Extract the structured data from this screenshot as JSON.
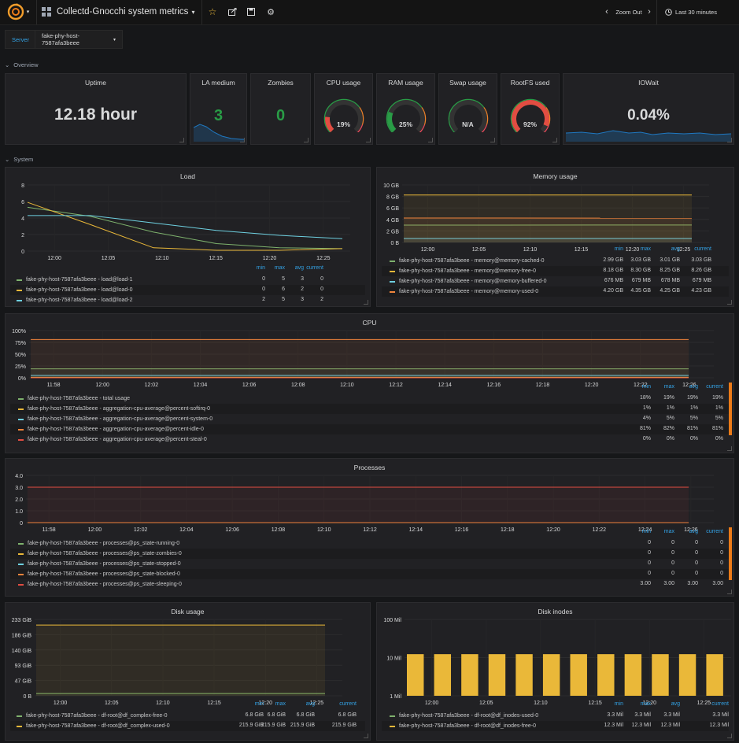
{
  "topbar": {
    "title": "Collectd-Gnocchi system metrics",
    "title_caret": "▾",
    "zoom_out": "Zoom Out",
    "time_range": "Last 30 minutes"
  },
  "variables": {
    "server_label": "Server",
    "server_value": "fake-phy-host-7587afa3beee"
  },
  "rows": {
    "overview": "Overview",
    "system": "System"
  },
  "stats": {
    "uptime": {
      "title": "Uptime",
      "value": "12.18 hour"
    },
    "la_medium": {
      "title": "LA medium",
      "value": "3"
    },
    "zombies": {
      "title": "Zombies",
      "value": "0"
    },
    "cpu_usage": {
      "title": "CPU usage",
      "value": "19%",
      "level": 0.19,
      "color": "#e24d42"
    },
    "ram_usage": {
      "title": "RAM usage",
      "value": "25%",
      "level": 0.25,
      "color": "#299c46"
    },
    "swap_usage": {
      "title": "Swap usage",
      "value": "N/A",
      "level": 0,
      "color": "#299c46"
    },
    "rootfs_used": {
      "title": "RootFS used",
      "value": "92%",
      "level": 0.92,
      "color": "#e24d42"
    },
    "iowait": {
      "title": "IOWait",
      "value": "0.04%"
    }
  },
  "colors": {
    "green": "#7eb26d",
    "yellow": "#eab839",
    "cyan": "#6ed0e0",
    "orange": "#ef843c",
    "red": "#e24d42",
    "blue_header": "#33a2e5",
    "stat_green": "#299c46"
  },
  "legend_headers": {
    "min": "min",
    "max": "max",
    "avg": "avg",
    "current": "current"
  },
  "panels": {
    "load": {
      "title": "Load",
      "yticks": [
        "8",
        "6",
        "4",
        "2",
        "0"
      ],
      "xticks": [
        "12:00",
        "12:05",
        "12:10",
        "12:15",
        "12:20",
        "12:25"
      ],
      "legend": [
        {
          "name": "fake-phy-host-7587afa3beee - load@load-1",
          "min": "0",
          "max": "5",
          "avg": "3",
          "current": "0"
        },
        {
          "name": "fake-phy-host-7587afa3beee - load@load-0",
          "min": "0",
          "max": "6",
          "avg": "2",
          "current": "0"
        },
        {
          "name": "fake-phy-host-7587afa3beee - load@load-2",
          "min": "2",
          "max": "5",
          "avg": "3",
          "current": "2"
        }
      ]
    },
    "memory": {
      "title": "Memory usage",
      "yticks": [
        "10 GB",
        "8 GB",
        "6 GB",
        "4 GB",
        "2 GB",
        "0 B"
      ],
      "xticks": [
        "12:00",
        "12:05",
        "12:10",
        "12:15",
        "12:20",
        "12:25"
      ],
      "legend": [
        {
          "name": "fake-phy-host-7587afa3beee - memory@memory-cached-0",
          "min": "2.99 GB",
          "max": "3.03 GB",
          "avg": "3.01 GB",
          "current": "3.03 GB"
        },
        {
          "name": "fake-phy-host-7587afa3beee - memory@memory-free-0",
          "min": "8.18 GB",
          "max": "8.30 GB",
          "avg": "8.25 GB",
          "current": "8.26 GB"
        },
        {
          "name": "fake-phy-host-7587afa3beee - memory@memory-buffered-0",
          "min": "676 MB",
          "max": "679 MB",
          "avg": "678 MB",
          "current": "679 MB"
        },
        {
          "name": "fake-phy-host-7587afa3beee - memory@memory-used-0",
          "min": "4.20 GB",
          "max": "4.35 GB",
          "avg": "4.25 GB",
          "current": "4.23 GB"
        }
      ]
    },
    "cpu": {
      "title": "CPU",
      "yticks": [
        "100%",
        "75%",
        "50%",
        "25%",
        "0%"
      ],
      "xticks": [
        "11:58",
        "12:00",
        "12:02",
        "12:04",
        "12:06",
        "12:08",
        "12:10",
        "12:12",
        "12:14",
        "12:16",
        "12:18",
        "12:20",
        "12:22",
        "12:26"
      ],
      "legend": [
        {
          "name": "fake-phy-host-7587afa3beee - total usage",
          "min": "18%",
          "max": "19%",
          "avg": "19%",
          "current": "19%"
        },
        {
          "name": "fake-phy-host-7587afa3beee - aggregation-cpu-average@percent-softirq-0",
          "min": "1%",
          "max": "1%",
          "avg": "1%",
          "current": "1%"
        },
        {
          "name": "fake-phy-host-7587afa3beee - aggregation-cpu-average@percent-system-0",
          "min": "4%",
          "max": "5%",
          "avg": "5%",
          "current": "5%"
        },
        {
          "name": "fake-phy-host-7587afa3beee - aggregation-cpu-average@percent-idle-0",
          "min": "81%",
          "max": "82%",
          "avg": "81%",
          "current": "81%"
        },
        {
          "name": "fake-phy-host-7587afa3beee - aggregation-cpu-average@percent-steal-0",
          "min": "0%",
          "max": "0%",
          "avg": "0%",
          "current": "0%"
        }
      ]
    },
    "processes": {
      "title": "Processes",
      "yticks": [
        "4.0",
        "3.0",
        "2.0",
        "1.0",
        "0"
      ],
      "xticks": [
        "11:58",
        "12:00",
        "12:02",
        "12:04",
        "12:06",
        "12:08",
        "12:10",
        "12:12",
        "12:14",
        "12:16",
        "12:18",
        "12:20",
        "12:22",
        "12:24",
        "12:26"
      ],
      "legend": [
        {
          "name": "fake-phy-host-7587afa3beee - processes@ps_state-running-0",
          "min": "0",
          "max": "0",
          "avg": "0",
          "current": "0"
        },
        {
          "name": "fake-phy-host-7587afa3beee - processes@ps_state-zombies-0",
          "min": "0",
          "max": "0",
          "avg": "0",
          "current": "0"
        },
        {
          "name": "fake-phy-host-7587afa3beee - processes@ps_state-stopped-0",
          "min": "0",
          "max": "0",
          "avg": "0",
          "current": "0"
        },
        {
          "name": "fake-phy-host-7587afa3beee - processes@ps_state-blocked-0",
          "min": "0",
          "max": "0",
          "avg": "0",
          "current": "0"
        },
        {
          "name": "fake-phy-host-7587afa3beee - processes@ps_state-sleeping-0",
          "min": "3.00",
          "max": "3.00",
          "avg": "3.00",
          "current": "3.00"
        }
      ]
    },
    "disk": {
      "title": "Disk usage",
      "yticks": [
        "233 GiB",
        "186 GiB",
        "140 GiB",
        "93 GiB",
        "47 GiB",
        "0 B"
      ],
      "xticks": [
        "12:00",
        "12:05",
        "12:10",
        "12:15",
        "12:20",
        "12:25"
      ],
      "legend": [
        {
          "name": "fake-phy-host-7587afa3beee - df-root@df_complex-free-0",
          "min": "6.8 GiB",
          "max": "6.8 GiB",
          "avg": "6.8 GiB",
          "current": "6.8 GiB"
        },
        {
          "name": "fake-phy-host-7587afa3beee - df-root@df_complex-used-0",
          "min": "215.9 GiB",
          "max": "215.9 GiB",
          "avg": "215.9 GiB",
          "current": "215.9 GiB"
        }
      ]
    },
    "inodes": {
      "title": "Disk inodes",
      "yticks": [
        "100 Mil",
        "10 Mil",
        "1 Mil"
      ],
      "xticks": [
        "12:00",
        "12:05",
        "12:10",
        "12:15",
        "12:20",
        "12:25"
      ],
      "legend": [
        {
          "name": "fake-phy-host-7587afa3beee - df-root@df_inodes-used-0",
          "min": "3.3 Mil",
          "max": "3.3 Mil",
          "avg": "3.3 Mil",
          "current": "3.3 Mil"
        },
        {
          "name": "fake-phy-host-7587afa3beee - df-root@df_inodes-free-0",
          "min": "12.3 Mil",
          "max": "12.3 Mil",
          "avg": "12.3 Mil",
          "current": "12.3 Mil"
        }
      ]
    }
  },
  "chart_data": [
    {
      "type": "line",
      "title": "Load",
      "x": [
        "11:58",
        "12:05",
        "12:10",
        "12:15",
        "12:20",
        "12:25"
      ],
      "ylim": [
        0,
        8
      ],
      "series": [
        {
          "name": "fake-phy-host-7587afa3beee - load@load-1",
          "values": [
            5.3,
            4.2,
            2.3,
            0.9,
            0.4,
            0.3
          ]
        },
        {
          "name": "fake-phy-host-7587afa3beee - load@load-0",
          "values": [
            5.9,
            3.2,
            0.4,
            0.1,
            0.1,
            0.3
          ]
        },
        {
          "name": "fake-phy-host-7587afa3beee - load@load-2",
          "values": [
            4.3,
            4.3,
            3.4,
            2.5,
            1.9,
            1.5
          ]
        }
      ]
    },
    {
      "type": "area",
      "title": "Memory usage",
      "unit": "GB",
      "x": [
        "11:56",
        "12:25"
      ],
      "ylim": [
        0,
        10
      ],
      "series": [
        {
          "name": "fake-phy-host-7587afa3beee - memory@memory-cached-0",
          "values": [
            3.01,
            3.03
          ]
        },
        {
          "name": "fake-phy-host-7587afa3beee - memory@memory-free-0",
          "values": [
            8.25,
            8.26
          ]
        },
        {
          "name": "fake-phy-host-7587afa3beee - memory@memory-buffered-0",
          "values": [
            0.678,
            0.679
          ]
        },
        {
          "name": "fake-phy-host-7587afa3beee - memory@memory-used-0",
          "values": [
            4.25,
            4.23
          ]
        }
      ]
    },
    {
      "type": "area",
      "title": "CPU",
      "unit": "%",
      "x": [
        "11:57",
        "12:24"
      ],
      "ylim": [
        0,
        100
      ],
      "series": [
        {
          "name": "fake-phy-host-7587afa3beee - total usage",
          "values": [
            19,
            19
          ]
        },
        {
          "name": "fake-phy-host-7587afa3beee - aggregation-cpu-average@percent-softirq-0",
          "values": [
            1,
            1
          ]
        },
        {
          "name": "fake-phy-host-7587afa3beee - aggregation-cpu-average@percent-system-0",
          "values": [
            5,
            5
          ]
        },
        {
          "name": "fake-phy-host-7587afa3beee - aggregation-cpu-average@percent-idle-0",
          "values": [
            81,
            81
          ]
        },
        {
          "name": "fake-phy-host-7587afa3beee - aggregation-cpu-average@percent-steal-0",
          "values": [
            0,
            0
          ]
        }
      ]
    },
    {
      "type": "line",
      "title": "Processes",
      "x": [
        "11:57",
        "12:25"
      ],
      "ylim": [
        0,
        4
      ],
      "series": [
        {
          "name": "fake-phy-host-7587afa3beee - processes@ps_state-running-0",
          "values": [
            0,
            0
          ]
        },
        {
          "name": "fake-phy-host-7587afa3beee - processes@ps_state-zombies-0",
          "values": [
            0,
            0
          ]
        },
        {
          "name": "fake-phy-host-7587afa3beee - processes@ps_state-stopped-0",
          "values": [
            0,
            0
          ]
        },
        {
          "name": "fake-phy-host-7587afa3beee - processes@ps_state-blocked-0",
          "values": [
            0,
            0
          ]
        },
        {
          "name": "fake-phy-host-7587afa3beee - processes@ps_state-sleeping-0",
          "values": [
            3,
            3
          ]
        }
      ]
    },
    {
      "type": "area",
      "title": "Disk usage",
      "unit": "GiB",
      "x": [
        "11:58",
        "12:25"
      ],
      "ylim": [
        0,
        233
      ],
      "series": [
        {
          "name": "fake-phy-host-7587afa3beee - df-root@df_complex-free-0",
          "values": [
            6.8,
            6.8
          ]
        },
        {
          "name": "fake-phy-host-7587afa3beee - df-root@df_complex-used-0",
          "values": [
            215.9,
            215.9
          ]
        }
      ]
    },
    {
      "type": "bar",
      "title": "Disk inodes",
      "yscale": "log",
      "unit": "Mil",
      "x": [
        "11:58",
        "12:01",
        "12:03",
        "12:06",
        "12:08",
        "12:11",
        "12:13",
        "12:16",
        "12:18",
        "12:21",
        "12:23",
        "12:26"
      ],
      "ylim": [
        1,
        100
      ],
      "series": [
        {
          "name": "fake-phy-host-7587afa3beee - df-root@df_inodes-used-0",
          "values": [
            3.3,
            3.3,
            3.3,
            3.3,
            3.3,
            3.3,
            3.3,
            3.3,
            3.3,
            3.3,
            3.3,
            3.3
          ]
        },
        {
          "name": "fake-phy-host-7587afa3beee - df-root@df_inodes-free-0",
          "values": [
            12.3,
            12.3,
            12.3,
            12.3,
            12.3,
            12.3,
            12.3,
            12.3,
            12.3,
            12.3,
            12.3,
            12.3
          ]
        }
      ]
    }
  ]
}
